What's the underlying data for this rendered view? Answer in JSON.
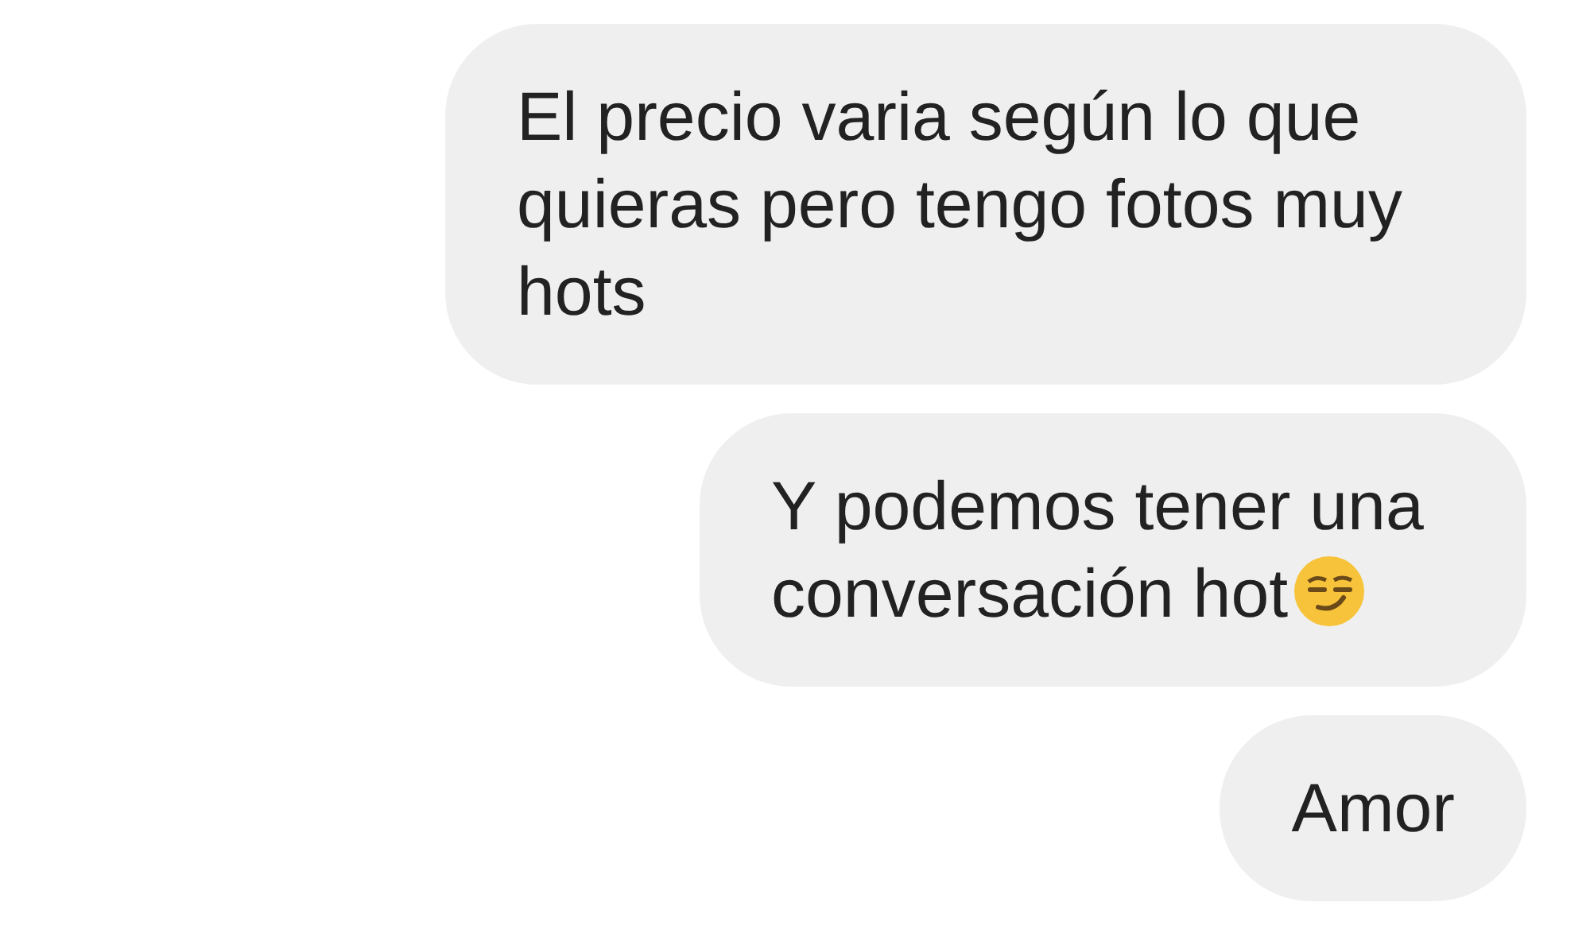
{
  "messages": [
    {
      "text": "El precio varia según lo que quieras pero tengo fotos muy hots"
    },
    {
      "text": "Y podemos tener una conversación hot",
      "trailing_emoji": true
    },
    {
      "text": "Amor"
    }
  ]
}
